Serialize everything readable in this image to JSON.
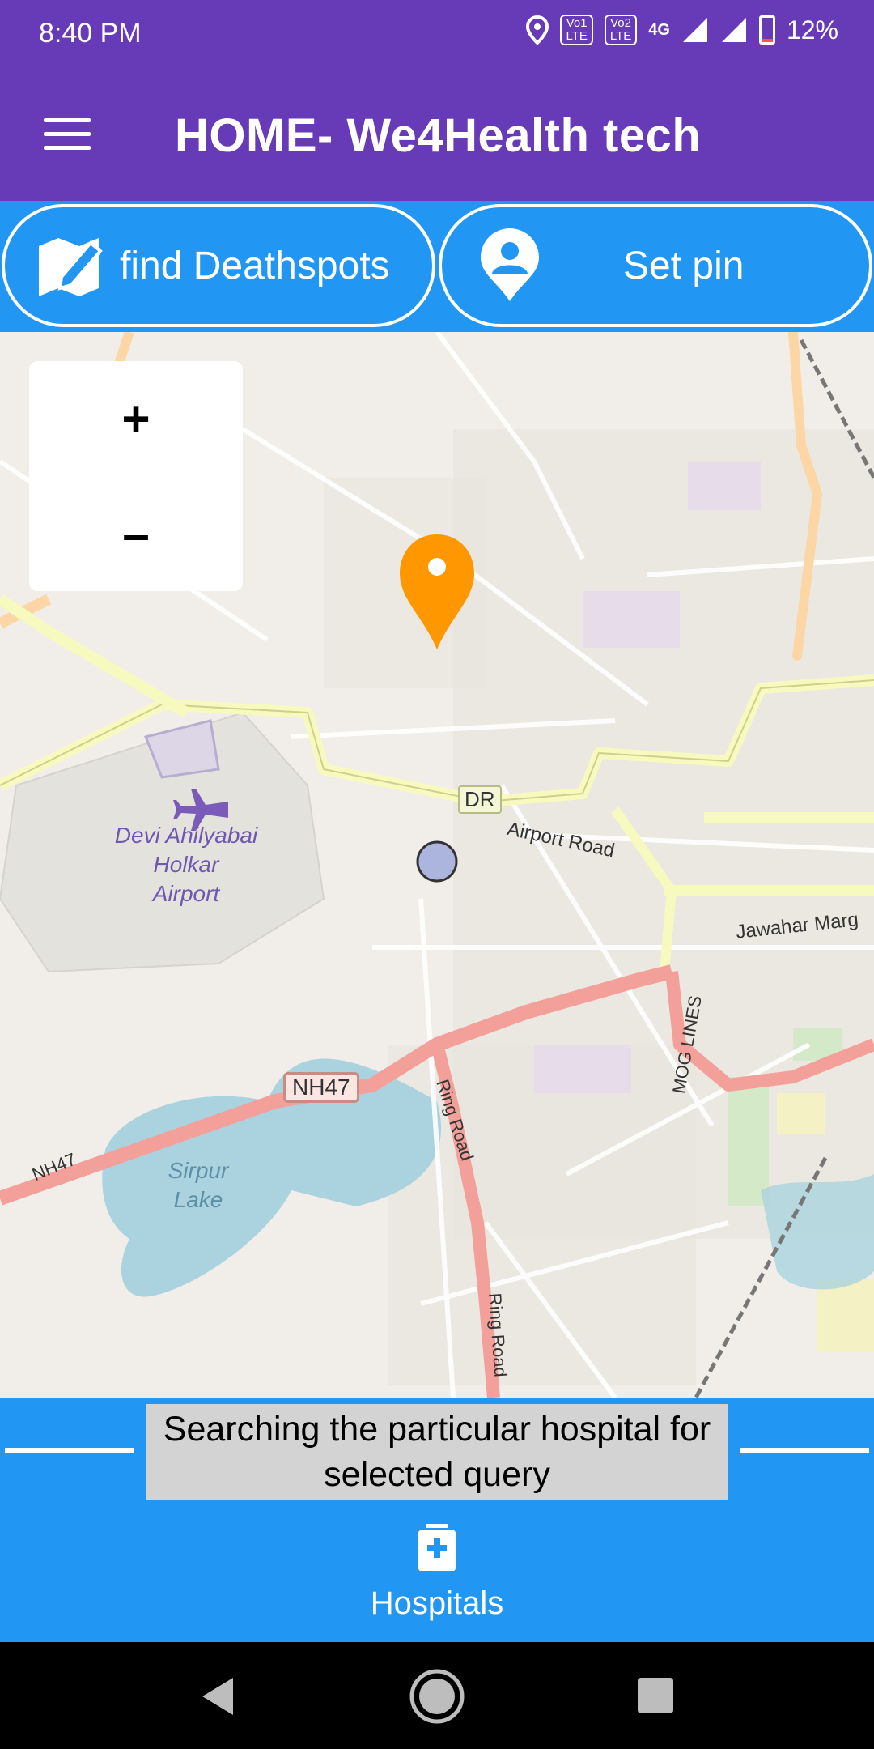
{
  "status_bar": {
    "time": "8:40 PM",
    "lte1": "Vo1\nLTE",
    "lte2": "Vo2\nLTE",
    "network": "4G",
    "battery": "12%",
    "battery_level": 0.12,
    "icons": [
      "location-icon",
      "signal-icon",
      "battery-icon"
    ]
  },
  "app_bar": {
    "title": "HOME- We4Health tech",
    "menu_icon": "hamburger-menu-icon"
  },
  "actions": {
    "find_label": "find Deathspots",
    "setpin_label": "Set pin"
  },
  "map": {
    "zoom_in": "+",
    "zoom_out": "–",
    "labels": {
      "airport": "Devi Ahilyabai\nHolkar\nAirport",
      "lake": "Sirpur\nLake",
      "nh47_a": "NH47",
      "nh47_b": "NH47",
      "airport_road": "Airport Road",
      "jawahar": "Jawahar Marg",
      "mog_lines": "MOG LINES",
      "ring_road_a": "Ring Road",
      "ring_road_b": "Ring Road",
      "dr": "DR"
    },
    "colors": {
      "water": "#aad3df",
      "primary_road": "#f7fabf",
      "trunk": "#f3a09a",
      "secondary": "#fcd6a4",
      "pin": "#ff9800"
    }
  },
  "search_status": {
    "message": "Searching the particular hospital for selected query"
  },
  "bottom_nav": {
    "hospitals_label": "Hospitals"
  },
  "colors": {
    "primary": "#673ab7",
    "accent": "#2196f3"
  }
}
